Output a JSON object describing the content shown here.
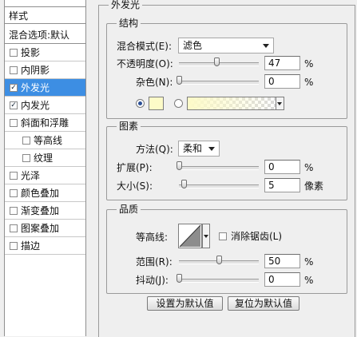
{
  "left": {
    "header": "样式",
    "blend_options": "混合选项:默认",
    "items": [
      {
        "label": "投影",
        "checked": false,
        "selected": false,
        "indent": false
      },
      {
        "label": "内阴影",
        "checked": false,
        "selected": false,
        "indent": false
      },
      {
        "label": "外发光",
        "checked": true,
        "selected": true,
        "indent": false
      },
      {
        "label": "内发光",
        "checked": true,
        "selected": false,
        "indent": false
      },
      {
        "label": "斜面和浮雕",
        "checked": false,
        "selected": false,
        "indent": false
      },
      {
        "label": "等高线",
        "checked": false,
        "selected": false,
        "indent": true
      },
      {
        "label": "纹理",
        "checked": false,
        "selected": false,
        "indent": true
      },
      {
        "label": "光泽",
        "checked": false,
        "selected": false,
        "indent": false
      },
      {
        "label": "颜色叠加",
        "checked": false,
        "selected": false,
        "indent": false
      },
      {
        "label": "渐变叠加",
        "checked": false,
        "selected": false,
        "indent": false
      },
      {
        "label": "图案叠加",
        "checked": false,
        "selected": false,
        "indent": false
      },
      {
        "label": "描边",
        "checked": false,
        "selected": false,
        "indent": false
      }
    ]
  },
  "panel": {
    "title": "外发光",
    "structure": {
      "title": "结构",
      "blend_mode_label": "混合模式(E):",
      "blend_mode_value": "滤色",
      "opacity_label": "不透明度(O):",
      "opacity_value": "47",
      "opacity_level": 47,
      "noise_label": "杂色(N):",
      "noise_value": "0",
      "noise_level": 0,
      "percent": "%",
      "solid_color": "#fdfbc8",
      "gradient_from": "#fdfbc8"
    },
    "elements": {
      "title": "图素",
      "technique_label": "方法(Q):",
      "technique_value": "柔和",
      "spread_label": "扩展(P):",
      "spread_value": "0",
      "spread_level": 0,
      "size_label": "大小(S):",
      "size_value": "5",
      "size_unit": "像素",
      "percent": "%"
    },
    "quality": {
      "title": "品质",
      "contour_label": "等高线:",
      "antialias_label": "消除锯齿(L)",
      "antialias_checked": false,
      "range_label": "范围(R):",
      "range_value": "50",
      "range_level": 50,
      "jitter_label": "抖动(J):",
      "jitter_value": "0",
      "jitter_level": 0,
      "percent": "%"
    },
    "buttons": {
      "make_default": "设置为默认值",
      "reset_default": "复位为默认值"
    }
  }
}
